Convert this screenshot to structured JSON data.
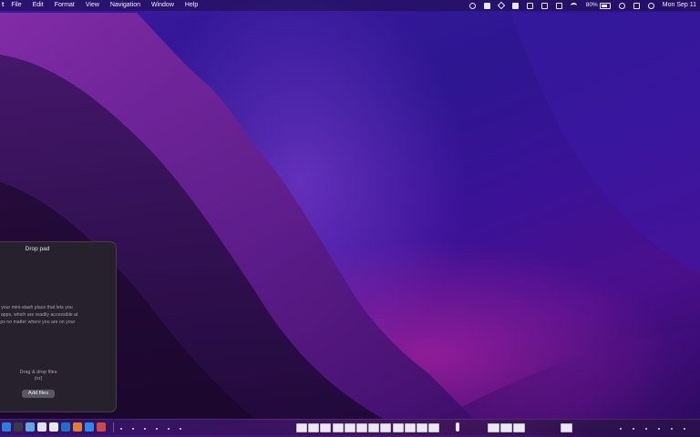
{
  "menubar": {
    "apple_label": "t",
    "menus": [
      "File",
      "Edit",
      "Format",
      "View",
      "Navigation",
      "Window",
      "Help"
    ],
    "status_icons": [
      "compass-icon",
      "user-badge-icon",
      "layers-icon",
      "window-icon",
      "display-icon",
      "cursor-icon",
      "monitor-icon",
      "wifi-icon"
    ],
    "battery_percent": "80%",
    "battery_level": 0.8,
    "right_icons": [
      "search-icon",
      "control-center-icon",
      "siri-icon"
    ],
    "clock": "Mon Sep 11"
  },
  "droppad": {
    "title": "Drop pad",
    "description_lines": [
      "is your mini-stash place that lets you",
      "& apps, which are readily accessible at",
      "rtips no matter where you are on your"
    ],
    "drag_text": "Drag & drop files",
    "or_text": "(or)",
    "add_button_label": "Add files"
  },
  "colors": {
    "menubar_bg": "#1e0e46",
    "panel_bg": "#26222c",
    "button_bg": "#5a5762"
  }
}
